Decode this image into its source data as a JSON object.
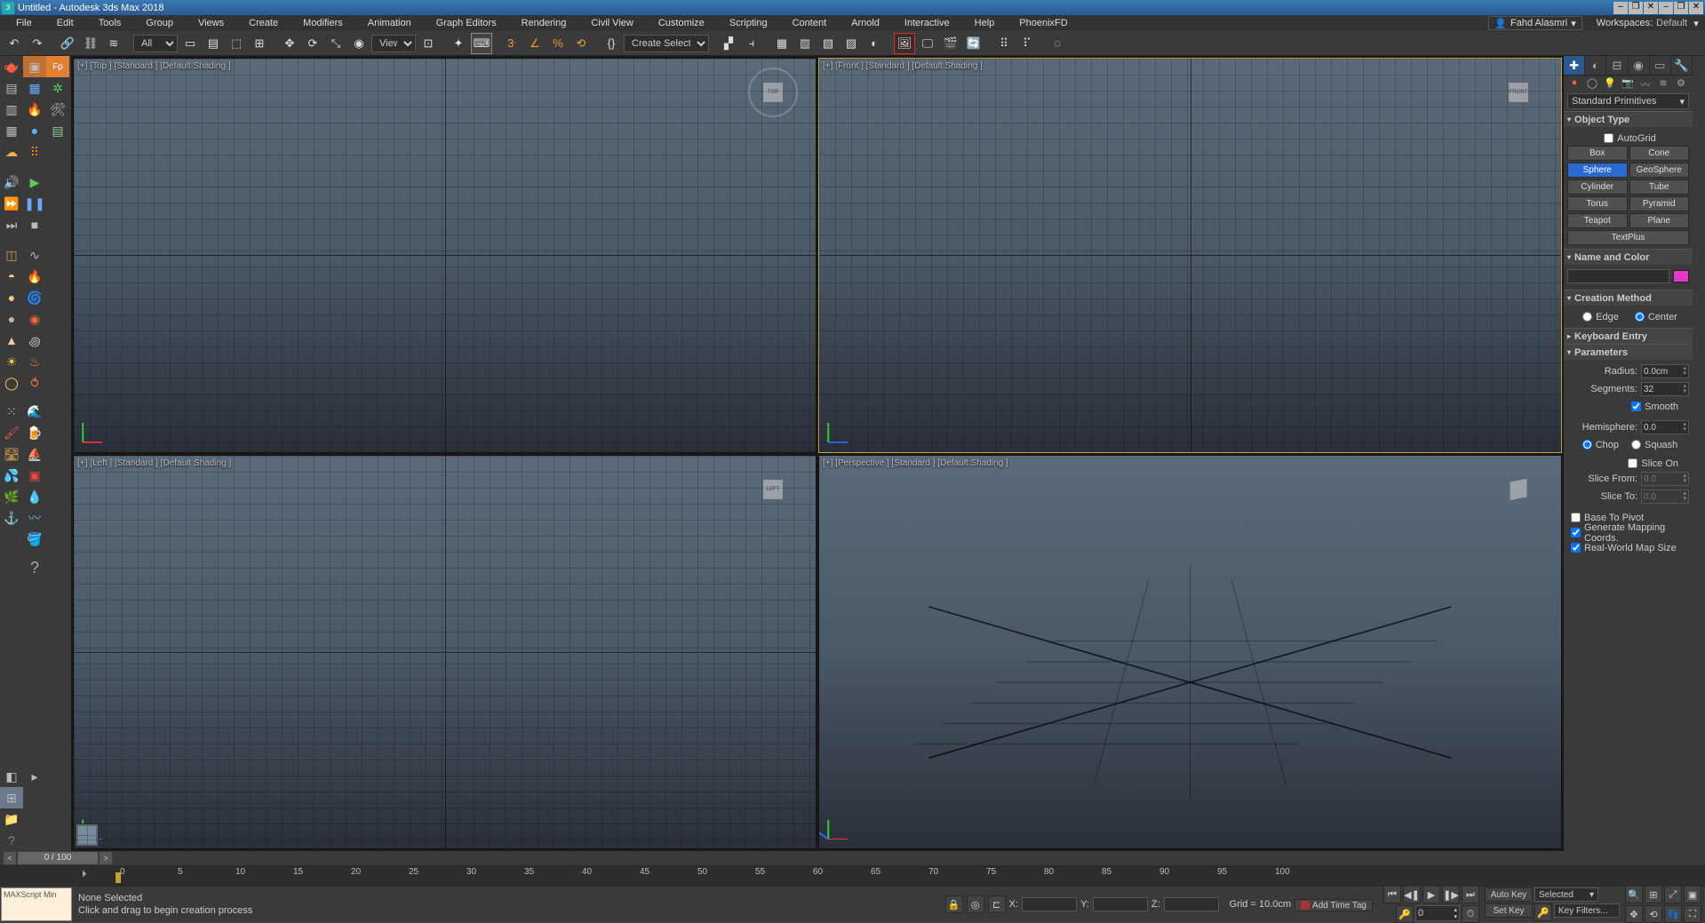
{
  "title": "Untitled - Autodesk 3ds Max 2018",
  "menus": [
    "File",
    "Edit",
    "Tools",
    "Group",
    "Views",
    "Create",
    "Modifiers",
    "Animation",
    "Graph Editors",
    "Rendering",
    "Civil View",
    "Customize",
    "Scripting",
    "Content",
    "Arnold",
    "Interactive",
    "Help",
    "PhoenixFD"
  ],
  "user": "Fahd Alasmri",
  "workspace_label": "Workspaces:",
  "workspace_value": "Default",
  "toolbar": {
    "filter_sel": "All",
    "view_sel": "View",
    "selset_sel": "Create Selection Se"
  },
  "viewports": {
    "top": "[+] [Top ] [Standard ] [Default Shading ]",
    "front": "[+] [Front ] [Standard ] [Default Shading ]",
    "left": "[+] [Left ] [Standard ] [Default Shading ]",
    "persp": "[+] [Perspective ] [Standard ] [Default Shading ]",
    "cube_top": "TOP",
    "cube_front": "FRONT",
    "cube_left": "LEFT"
  },
  "cmd": {
    "dropdown": "Standard Primitives",
    "roll_obj": "Object Type",
    "autogrid": "AutoGrid",
    "objs": [
      "Box",
      "Cone",
      "Sphere",
      "GeoSphere",
      "Cylinder",
      "Tube",
      "Torus",
      "Pyramid",
      "Teapot",
      "Plane",
      "TextPlus"
    ],
    "obj_active": "Sphere",
    "roll_name": "Name and Color",
    "roll_method": "Creation Method",
    "method_edge": "Edge",
    "method_center": "Center",
    "roll_kbd": "Keyboard Entry",
    "roll_params": "Parameters",
    "radius_lbl": "Radius:",
    "radius_val": "0.0cm",
    "seg_lbl": "Segments:",
    "seg_val": "32",
    "smooth": "Smooth",
    "hemi_lbl": "Hemisphere:",
    "hemi_val": "0.0",
    "chop": "Chop",
    "squash": "Squash",
    "slice_on": "Slice On",
    "slice_from_lbl": "Slice From:",
    "slice_from_val": "0.0",
    "slice_to_lbl": "Slice To:",
    "slice_to_val": "0.0",
    "base_pivot": "Base To Pivot",
    "gen_map": "Generate Mapping Coords.",
    "rw_map": "Real-World Map Size"
  },
  "timeslider": {
    "pos": "0 / 100"
  },
  "trackbar_nums": [
    0,
    5,
    10,
    15,
    20,
    25,
    30,
    35,
    40,
    45,
    50,
    55,
    60,
    65,
    70,
    75,
    80,
    85,
    90,
    95,
    100
  ],
  "status": {
    "script": "MAXScript Min",
    "sel": "None Selected",
    "prompt": "Click and drag to begin creation process",
    "x": "X:",
    "y": "Y:",
    "z": "Z:",
    "grid": "Grid = 10.0cm",
    "addtag": "Add Time Tag",
    "autokey": "Auto Key",
    "setkey": "Set Key",
    "selected": "Selected",
    "keyfilters": "Key Filters...",
    "frame": "0"
  }
}
